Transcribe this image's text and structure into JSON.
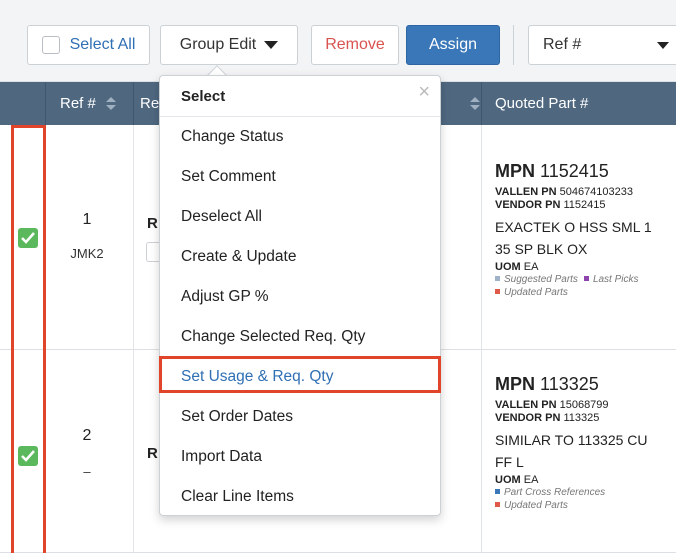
{
  "toolbar": {
    "select_all": "Select All",
    "group_edit": "Group Edit",
    "remove": "Remove",
    "assign": "Assign",
    "ref_select_value": "Ref #"
  },
  "table": {
    "headers": {
      "ref": "Ref #",
      "req": "Re",
      "quoted_part": "Quoted Part #"
    }
  },
  "rows": [
    {
      "ref": "1",
      "sub": "JMK2",
      "partial_col": "R",
      "mpn_label": "MPN",
      "mpn": "1152415",
      "vallen_label": "VALLEN PN",
      "vallen": "504674103233",
      "vendor_label": "VENDOR PN",
      "vendor": "1152415",
      "desc1": "EXACTEK O HSS SML 1",
      "desc2": "35 SP BLK OX",
      "uom_label": "UOM",
      "uom": "EA",
      "tags": [
        {
          "label": "Suggested Parts",
          "color": "#9fb3c8"
        },
        {
          "label": "Last Picks",
          "color": "#8e44ad"
        },
        {
          "label": "Updated Parts",
          "color": "#e05a4a"
        }
      ]
    },
    {
      "ref": "2",
      "sub": "–",
      "partial_col": "R",
      "mpn_label": "MPN",
      "mpn": "113325",
      "vallen_label": "VALLEN PN",
      "vallen": "15068799",
      "vendor_label": "VENDOR PN",
      "vendor": "113325",
      "desc1": "SIMILAR TO 113325 CU",
      "desc2": "FF L",
      "uom_label": "UOM",
      "uom": "EA",
      "tags": [
        {
          "label": "Part Cross References",
          "color": "#3a77b8"
        },
        {
          "label": "Updated Parts",
          "color": "#e05a4a"
        }
      ]
    }
  ],
  "dropdown": {
    "header": "Select",
    "close": "×",
    "items": [
      "Change Status",
      "Set Comment",
      "Deselect All",
      "Create & Update",
      "Adjust GP %",
      "Change Selected Req. Qty",
      "Set Usage & Req. Qty",
      "Set Order Dates",
      "Import Data",
      "Clear Line Items"
    ],
    "active_item": "Set Usage & Req. Qty"
  },
  "colors": {
    "header_bg": "#4f6880",
    "assign_bg": "#3a77b8",
    "checkbox_green": "#5cb85c",
    "highlight_red": "#e0452c",
    "remove_red": "#d9534f"
  }
}
